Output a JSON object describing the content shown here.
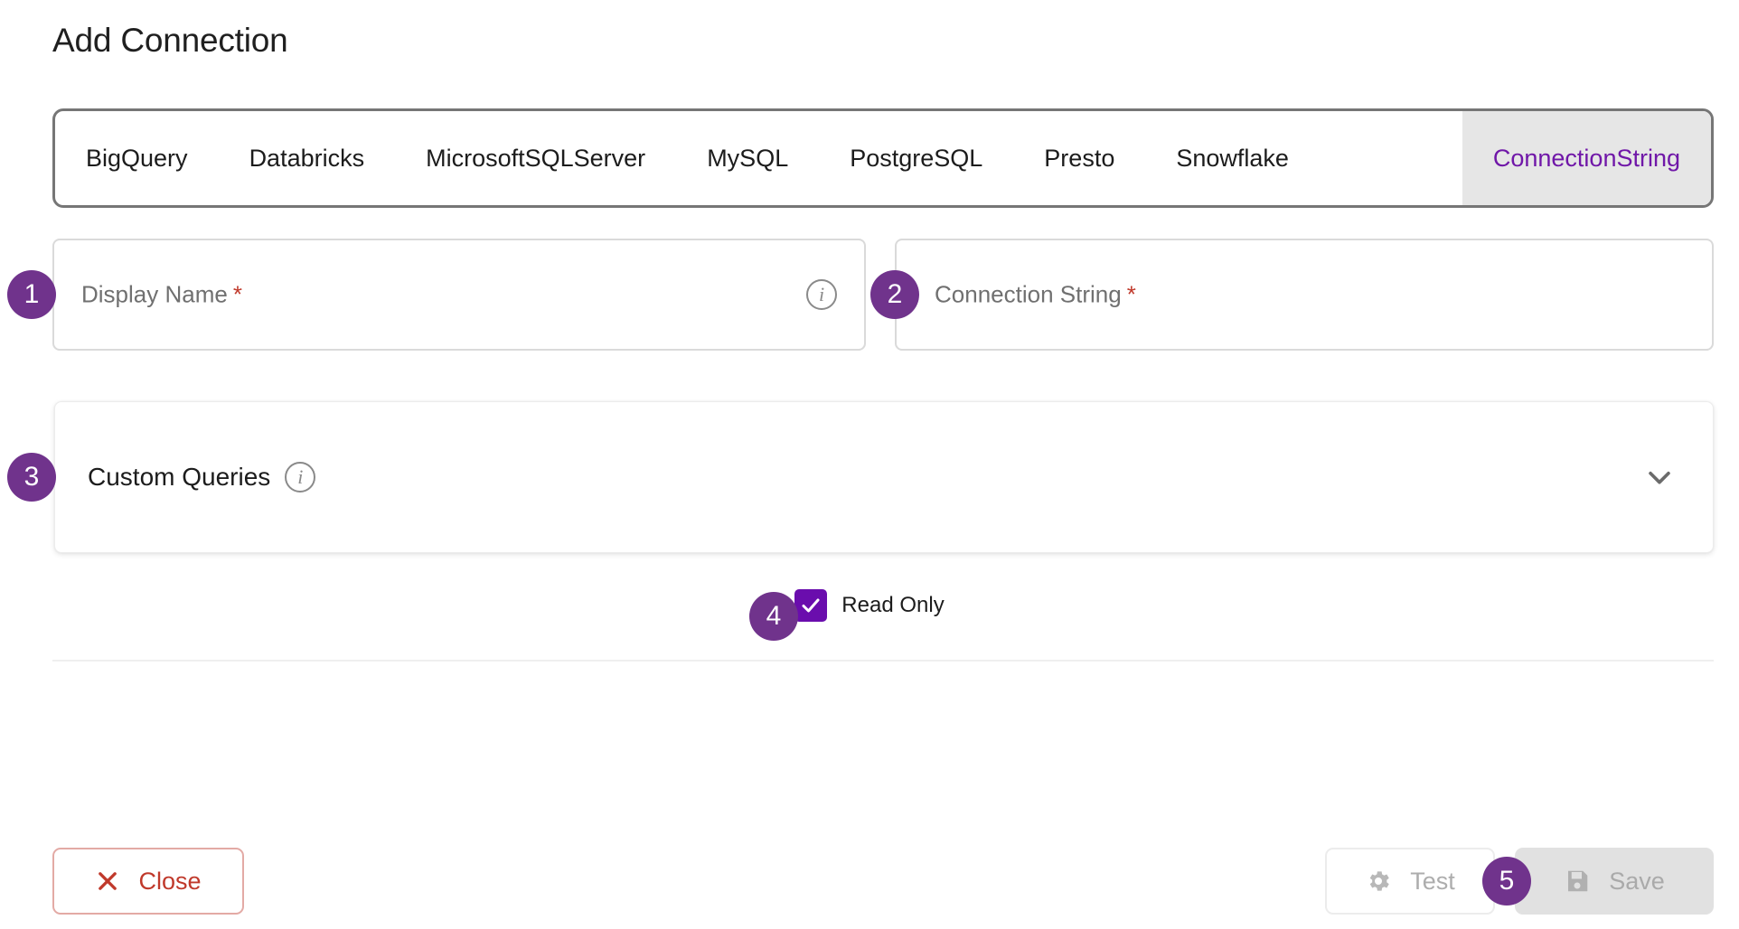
{
  "dialog": {
    "title": "Add Connection"
  },
  "tabs": {
    "items": [
      {
        "label": "BigQuery",
        "active": false
      },
      {
        "label": "Databricks",
        "active": false
      },
      {
        "label": "MicrosoftSQLServer",
        "active": false
      },
      {
        "label": "MySQL",
        "active": false
      },
      {
        "label": "PostgreSQL",
        "active": false
      },
      {
        "label": "Presto",
        "active": false
      },
      {
        "label": "Snowflake",
        "active": false
      },
      {
        "label": "ConnectionString",
        "active": true
      }
    ],
    "active_label": "ConnectionString"
  },
  "form": {
    "display_name": {
      "label": "Display Name",
      "required_marker": "*",
      "value": "",
      "placeholder": "Display Name",
      "info_icon": "info-icon",
      "info_glyph": "i"
    },
    "connection_string": {
      "label": "Connection String",
      "required_marker": "*",
      "value": "",
      "placeholder": "Connection String"
    },
    "custom_queries": {
      "label": "Custom Queries",
      "info_icon": "info-icon",
      "info_glyph": "i",
      "expand_icon": "chevron-down-icon",
      "expanded": "false"
    },
    "read_only": {
      "label": "Read Only",
      "checked": "true",
      "check_glyph": "checkmark-icon"
    }
  },
  "footer": {
    "close": {
      "label": "Close",
      "icon": "close-x-icon"
    },
    "test": {
      "label": "Test",
      "icon": "gear-icon",
      "disabled": "true"
    },
    "save": {
      "label": "Save",
      "icon": "floppy-disk-save-icon",
      "disabled": "true"
    }
  },
  "annotations": {
    "badges": [
      "1",
      "2",
      "3",
      "4",
      "5"
    ]
  },
  "colors": {
    "badge_purple": "#70338c",
    "checkbox_purple": "#6a0dad",
    "active_tab_text": "#7017a8",
    "active_tab_bg": "#e6e6e6",
    "required_red": "#c0392b",
    "close_red": "#c0392b",
    "disabled_gray": "#aaaaaa"
  }
}
